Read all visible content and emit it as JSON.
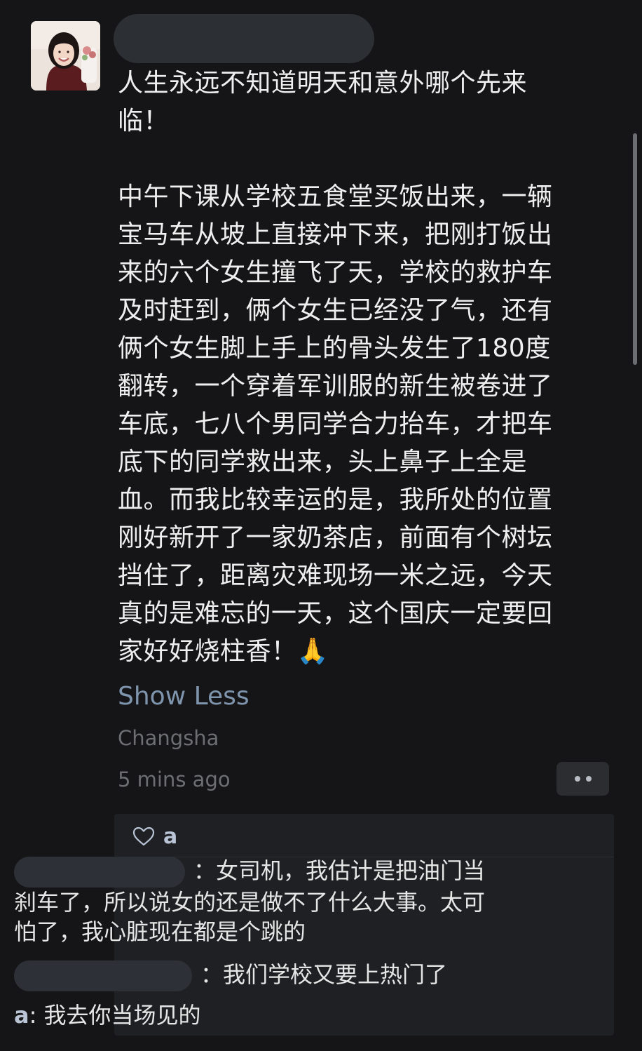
{
  "post": {
    "avatar_icon": "user-avatar-photo",
    "text": "人生永远不知道明天和意外哪个先来\n临！\n\n中午下课从学校五食堂买饭出来，一辆\n宝马车从坡上直接冲下来，把刚打饭出\n来的六个女生撞飞了天，学校的救护车\n及时赶到，俩个女生已经没了气，还有\n俩个女生脚上手上的骨头发生了180度\n翻转，一个穿着军训服的新生被卷进了\n车底，七八个男同学合力抬车，才把车\n底下的同学救出来，头上鼻子上全是\n血。而我比较幸运的是，我所处的位置\n刚好新开了一家奶茶店，前面有个树坛\n挡住了，距离灾难现场一米之远，今天\n真的是难忘的一天，这个国庆一定要回\n家好好烧柱香！🙏",
    "show_less_label": "Show Less",
    "location": "Changsha",
    "time": "5 mins ago"
  },
  "likes": {
    "icon": "heart-icon",
    "names": "a"
  },
  "comments": [
    {
      "name": "",
      "separator": "：",
      "text": "女司机，我估计是把油门当刹车了，所以说女的还是做不了什么大事。太可怕了，我心脏现在都是个跳的"
    },
    {
      "name": "",
      "separator": "：",
      "text": "我们学校又要上热门了"
    },
    {
      "name": "a",
      "separator": ": ",
      "text": "我去你当场见的"
    }
  ],
  "colors": {
    "background": "#151517",
    "text": "#efefef",
    "link": "#7f95ad",
    "meta": "#6c6e72",
    "comment_name": "#b9c5d6",
    "comment_bg": "#1f2023"
  }
}
